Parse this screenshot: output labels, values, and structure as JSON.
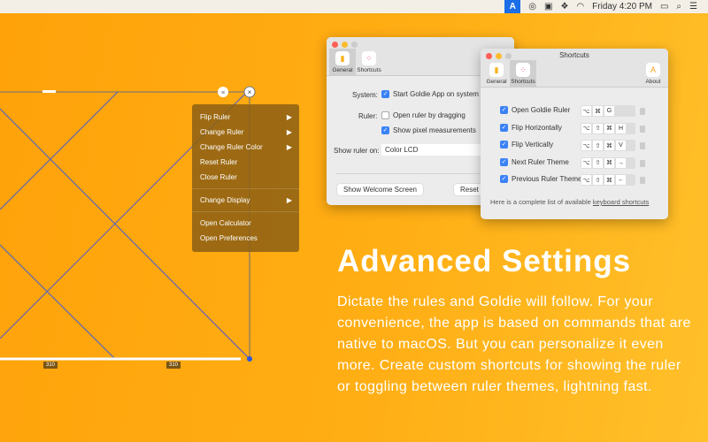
{
  "menubar": {
    "clock": "Friday 4:20 PM",
    "icons": [
      "goldie-app-icon",
      "creative-cloud-icon",
      "istat-icon",
      "dropbox-icon",
      "wifi-icon",
      "battery-icon",
      "spotlight-search-icon",
      "notification-center-icon"
    ]
  },
  "ruler": {
    "measure_left": "310",
    "measure_right": "310",
    "line_color": "#6a6aa8"
  },
  "context_menu": {
    "items": [
      {
        "label": "Flip Ruler",
        "submenu": true
      },
      {
        "label": "Change Ruler",
        "submenu": true
      },
      {
        "label": "Change Ruler Color",
        "submenu": true
      },
      {
        "label": "Reset Ruler"
      },
      {
        "label": "Close Ruler"
      },
      {
        "label": "Change Display",
        "submenu": true
      },
      {
        "label": "Open Calculator"
      },
      {
        "label": "Open Preferences"
      }
    ],
    "arrow": "▶"
  },
  "general_window": {
    "tabs": [
      "General",
      "Shortcuts"
    ],
    "system_label": "System:",
    "system_option": "Start Goldie App on system st",
    "ruler_label": "Ruler:",
    "ruler_opt1": "Open ruler by dragging",
    "ruler_opt2": "Show pixel measurements",
    "show_on_label": "Show ruler on:",
    "show_on_value": "Color LCD",
    "welcome_button": "Show Welcome Screen",
    "reset_button": "Reset"
  },
  "shortcuts_window": {
    "title": "Shortcuts",
    "tabs": [
      "General",
      "Shortcuts",
      "About"
    ],
    "rows": [
      {
        "label": "Open Goldie Ruler",
        "keys": [
          "⌥",
          "⌘",
          "G"
        ]
      },
      {
        "label": "Flip Horizontally",
        "keys": [
          "⌥",
          "⇧",
          "⌘",
          "H"
        ]
      },
      {
        "label": "Flip Vertically",
        "keys": [
          "⌥",
          "⇧",
          "⌘",
          "V"
        ]
      },
      {
        "label": "Next Ruler Theme",
        "keys": [
          "⌥",
          "⇧",
          "⌘",
          "→"
        ]
      },
      {
        "label": "Previous Ruler Theme",
        "keys": [
          "⌥",
          "⇧",
          "⌘",
          "←"
        ]
      }
    ],
    "footer_text": "Here is a complete list of available ",
    "footer_link": "keyboard shortcuts"
  },
  "headline": "Advanced Settings",
  "description": "Dictate the rules and Goldie will follow. For your convenience, the app is based on commands that are native to macOS. But you can personalize it even more. Create custom shortcuts for showing the ruler or toggling between ruler themes, lightning fast."
}
